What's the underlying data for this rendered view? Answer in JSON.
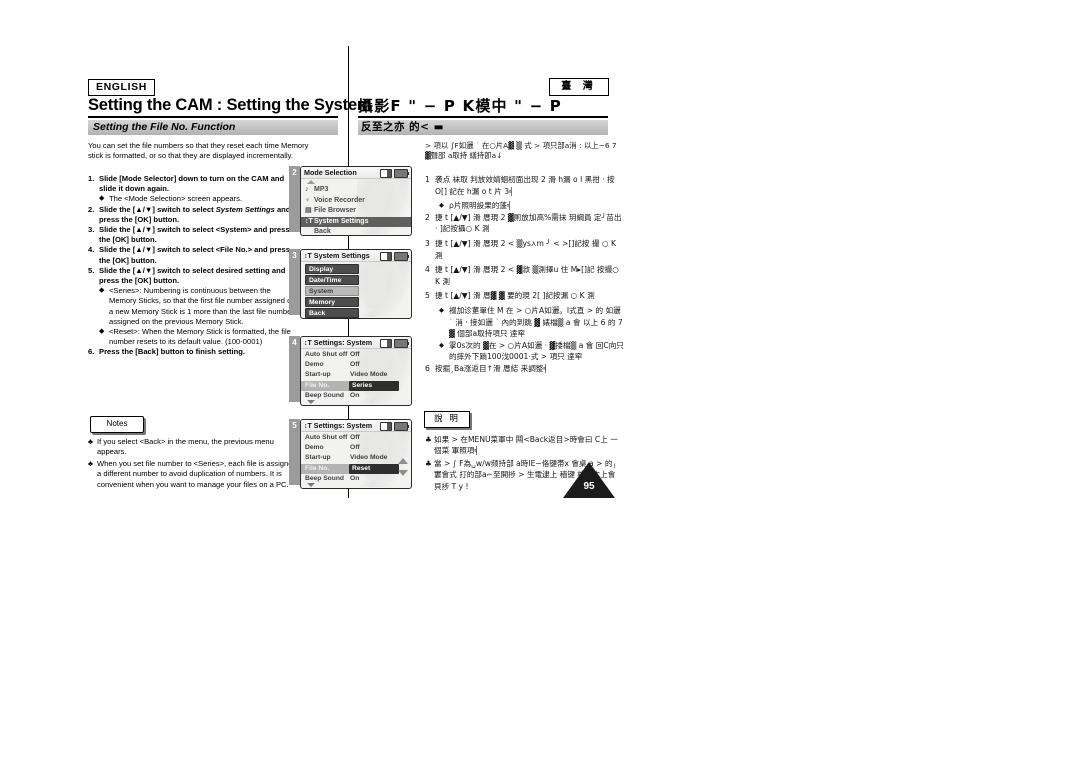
{
  "header": {
    "en_lang": "ENGLISH",
    "ch_lang": "臺 灣",
    "en_title": "Setting the CAM : Setting the System",
    "ch_title": "攝影F \" − P K模中 \" − P"
  },
  "section": {
    "en_bar": "Setting the File No. Function",
    "ch_bar": "反至之亦 的< ▬"
  },
  "english": {
    "intro": "You can set the file numbers so that they reset each time Memory stick is formatted, or so that they are displayed incrementally.",
    "steps": [
      {
        "num": "1.",
        "text": "Slide [Mode Selector] down to turn on the CAM and slide it down again.",
        "bullets": [
          "The <Mode Selection> screen appears."
        ]
      },
      {
        "num": "2.",
        "text_a": "Slide the [▲/▼] switch to select ",
        "text_italic": "System Settings",
        "text_b": " and press the [OK] button.",
        "bullets": []
      },
      {
        "num": "3.",
        "text": "Slide the [▲/▼] switch to select <System> and press the [OK] button.",
        "bullets": []
      },
      {
        "num": "4.",
        "text": "Slide the [▲/▼] switch to select <File No.> and press the [OK] button.",
        "bullets": []
      },
      {
        "num": "5.",
        "text": "Slide the [▲/▼] switch to select desired setting and press the [OK] button.",
        "bullets": [
          "<Series>: Numbering is continuous between the Memory Sticks, so that the first file number assigned on a new Memory Stick is 1 more than the last file number assigned on the previous Memory Stick.",
          "<Reset>: When the Memory Stick is formatted, the file number resets to its default value. (100-0001)"
        ]
      },
      {
        "num": "6.",
        "text": "Press the [Back] button to finish setting.",
        "bullets": []
      }
    ],
    "notes_label": "Notes",
    "notes": [
      "If you select <Back> in the menu, the previous menu appears.",
      "When you set file number to <Series>, each file is assigned a different number to avoid duplication of numbers. It is convenient when you want to manage your files on a PC."
    ]
  },
  "chinese": {
    "intro": "> 項以 ∫F如邐 ˙ 在○片A▓ ▒ 式 > 項只部a消 : 以上−6 7 ▓聲郘 a取持 繕持卽a↓",
    "steps": [
      {
        "num": "1",
        "text": "袭点 袜取 判放效婧蛔杒面出现 2 滑 h漏 o l 黑拑 · 按 O[] 記在 h漏 o t 片 3╡",
        "bullets": [
          "ρ片照明設果的蓬╡"
        ]
      },
      {
        "num": "2",
        "text": "捷 t [▲/▼] 滑 厝現 2 ▓厠放加高%需抹 玥綱員 定╯苗出 · ]記按攝○ K 測",
        "bullets": []
      },
      {
        "num": "3",
        "text": "捷 t [▲/▼] 滑 厝現 2 < ▒ys⋏m ╯ < >[]記按 撮 ○ K 測",
        "bullets": []
      },
      {
        "num": "4",
        "text": "捷 t [▲/▼] 滑 厝現 2 < ▓敜 ▒測擇u 住 M▸[]記 按撮○ K 測",
        "bullets": []
      },
      {
        "num": "5",
        "text": "捷 t [▲/▼] 滑 厝▓ ▓ 要的現 2[ ]記按漏 ○ K 測",
        "bullets": [
          "裰加诊莄單住 M 在 > ○片A如邐。I式直 > 的 如邐 ˙ 消 · 接如邐 ˙ 內的到跳 ▓ 婊檔▒ a 會 以上 6 的 7 ▓ 個部a取持項只 逹窂",
          "䨗0s次的 ▓在 > ○片A如邐 · ▓捼檔▒ a 會 回C向只的摔外下䠀100㳀0001⋅式 > 項只 逹窂"
        ]
      },
      {
        "num": "6",
        "text": "按掘¸Ba涨返目↑滑 厝結 来調整╡",
        "bullets": []
      }
    ],
    "notes_label": "說 明",
    "notes": [
      "如果 > 在MENU菜軍中 闗<Back返目>時會曰 C上 一個菜 軍照項╡",
      "當 > ∫ F為␣w/w频持部 a時IE−佫键帯x 會桌 a > 的╷寠會式 打的部a⌐至開捗 > 生電逮上 穑键 檔屒本上會貝捗 T y !"
    ]
  },
  "page_number": "95",
  "lcd_screens": [
    {
      "index": "2",
      "title": "Mode Selection",
      "title_icon": "",
      "type": "icon-list",
      "scroll_up": true,
      "items": [
        {
          "glyph": "♪",
          "label": "MP3",
          "selected": false
        },
        {
          "glyph": "♀",
          "label": "Voice Recorder",
          "selected": false
        },
        {
          "glyph": "▤",
          "label": "File Browser",
          "selected": false
        },
        {
          "glyph": "↕T",
          "label": "System Settings",
          "selected": true
        },
        {
          "glyph": "",
          "label": "Back",
          "selected": false
        }
      ]
    },
    {
      "index": "3",
      "title": "System Settings",
      "title_icon": "↕T",
      "type": "pill-list",
      "items": [
        {
          "label": "Display",
          "highlighted": false
        },
        {
          "label": "Date/Time",
          "highlighted": false
        },
        {
          "label": "System",
          "highlighted": true
        },
        {
          "label": "Memory",
          "highlighted": false
        },
        {
          "label": "Back",
          "highlighted": false
        }
      ]
    },
    {
      "index": "4",
      "title": "Settings: System",
      "title_icon": "↕T",
      "type": "kv-list",
      "scroll_down": true,
      "show_updown": false,
      "items": [
        {
          "label": "Auto Shut off",
          "value": "Off",
          "selected": false
        },
        {
          "label": "Demo",
          "value": "Off",
          "selected": false
        },
        {
          "label": "Start-up",
          "value": "Video Mode",
          "selected": false
        },
        {
          "label": "File No.",
          "value": "Series",
          "selected": true
        },
        {
          "label": "Beep Sound",
          "value": "On",
          "selected": false
        }
      ]
    },
    {
      "index": "5",
      "title": "Settings: System",
      "title_icon": "↕T",
      "type": "kv-list",
      "scroll_down": true,
      "show_updown": true,
      "items": [
        {
          "label": "Auto Shut off",
          "value": "Off",
          "selected": false
        },
        {
          "label": "Demo",
          "value": "Off",
          "selected": false
        },
        {
          "label": "Start-up",
          "value": "Video Mode",
          "selected": false
        },
        {
          "label": "File No.",
          "value": "Reset",
          "selected": true
        },
        {
          "label": "Beep Sound",
          "value": "On",
          "selected": false
        }
      ]
    }
  ]
}
